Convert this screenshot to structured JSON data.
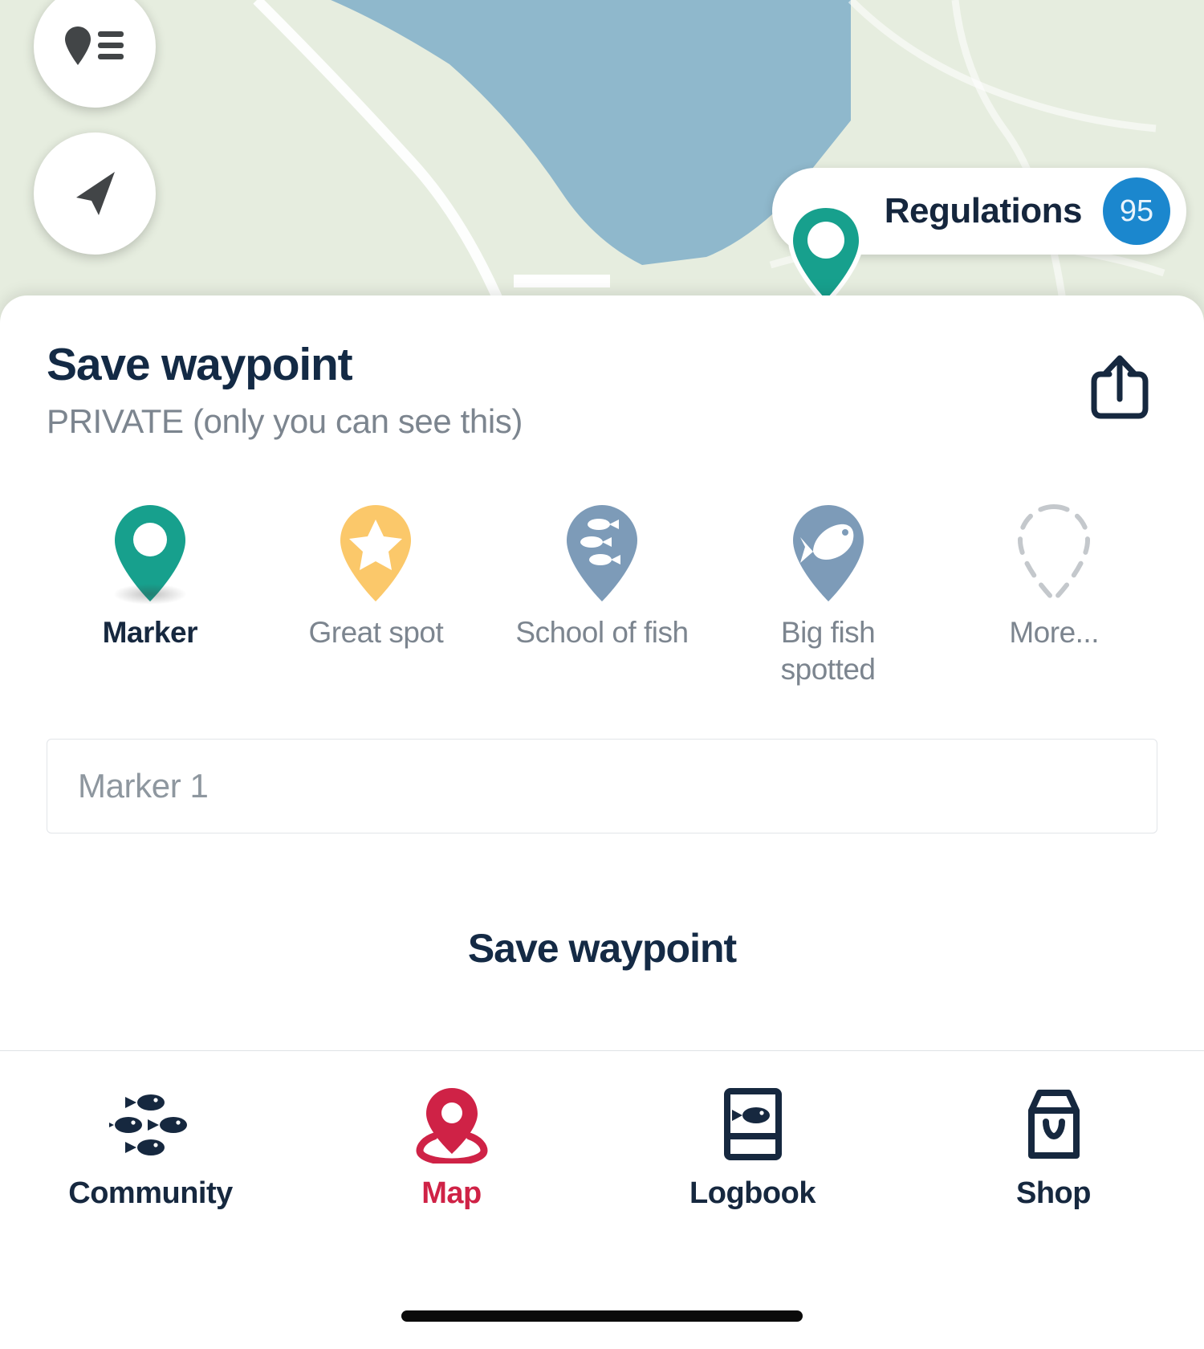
{
  "map": {
    "controls": [
      {
        "name": "waypoint-list-button",
        "icon": "pin-list-icon"
      },
      {
        "name": "locate-me-button",
        "icon": "navigation-arrow-icon"
      }
    ],
    "regulations_pill": {
      "label": "Regulations",
      "badge_count": "95",
      "badge_color": "#1b87ce",
      "marker_color": "#17a08d"
    },
    "colors": {
      "land": "#e6eddf",
      "water": "#8fb8cc",
      "road": "#ffffff"
    }
  },
  "sheet": {
    "title": "Save waypoint",
    "subtitle": "PRIVATE (only you can see this)",
    "share_icon": "share-icon",
    "types": [
      {
        "label": "Marker",
        "icon": "pin-plain-icon",
        "color": "#17a08d",
        "selected": true
      },
      {
        "label": "Great spot",
        "icon": "pin-star-icon",
        "color": "#fbc86a",
        "selected": false
      },
      {
        "label": "School of fish",
        "icon": "pin-school-fish-icon",
        "color": "#7d9bb8",
        "selected": false
      },
      {
        "label": "Big fish spotted",
        "icon": "pin-big-fish-icon",
        "color": "#7d9bb8",
        "selected": false
      },
      {
        "label": "More...",
        "icon": "pin-dashed-more-icon",
        "color": "#c4c8cc",
        "selected": false
      }
    ],
    "name_input": {
      "value": "",
      "placeholder": "Marker 1"
    },
    "save_button": "Save waypoint"
  },
  "bottom_nav": {
    "items": [
      {
        "label": "Community",
        "icon": "fish-cluster-icon",
        "active": false
      },
      {
        "label": "Map",
        "icon": "map-pin-icon",
        "active": true
      },
      {
        "label": "Logbook",
        "icon": "book-fish-icon",
        "active": false
      },
      {
        "label": "Shop",
        "icon": "shopping-bag-icon",
        "active": false
      }
    ],
    "active_color": "#cf2246",
    "inactive_color": "#16283f"
  }
}
